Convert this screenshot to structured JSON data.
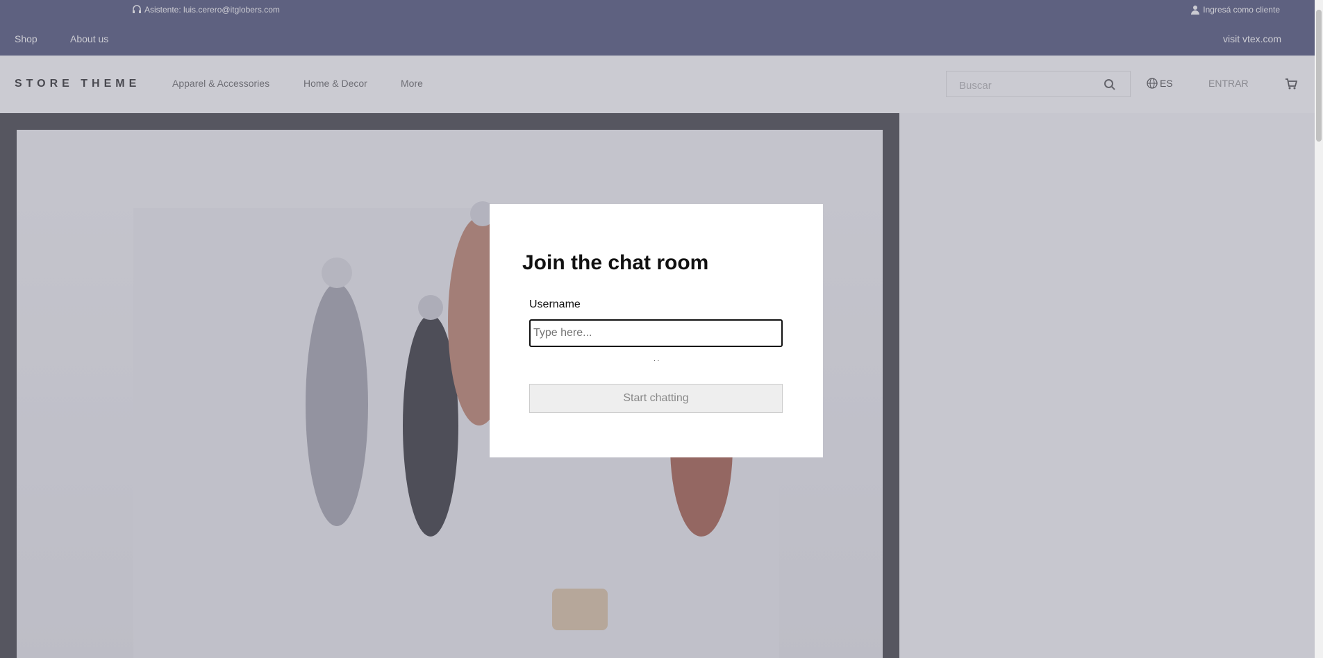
{
  "topbar": {
    "agent_text": "Asistente: luis.cerero@itglobers.com",
    "login_text": "Ingresá como cliente",
    "nav": [
      "Shop",
      "About us"
    ],
    "vtex_link": "visit vtex.com",
    "background_color": "#3a3f6b"
  },
  "header": {
    "logo": "STORE THEME",
    "menu": [
      "Apparel & Accessories",
      "Home & Decor",
      "More"
    ],
    "search_placeholder": "Buscar",
    "language": "ES",
    "login_button": "ENTRAR",
    "icons": [
      "search-icon",
      "globe-icon",
      "cart-icon",
      "headset-icon",
      "user-icon"
    ]
  },
  "modal": {
    "title": "Join the chat room",
    "username_label": "Username",
    "username_placeholder": "Type here...",
    "username_value": "",
    "loading_dots": ". .",
    "submit_label": "Start chatting"
  }
}
